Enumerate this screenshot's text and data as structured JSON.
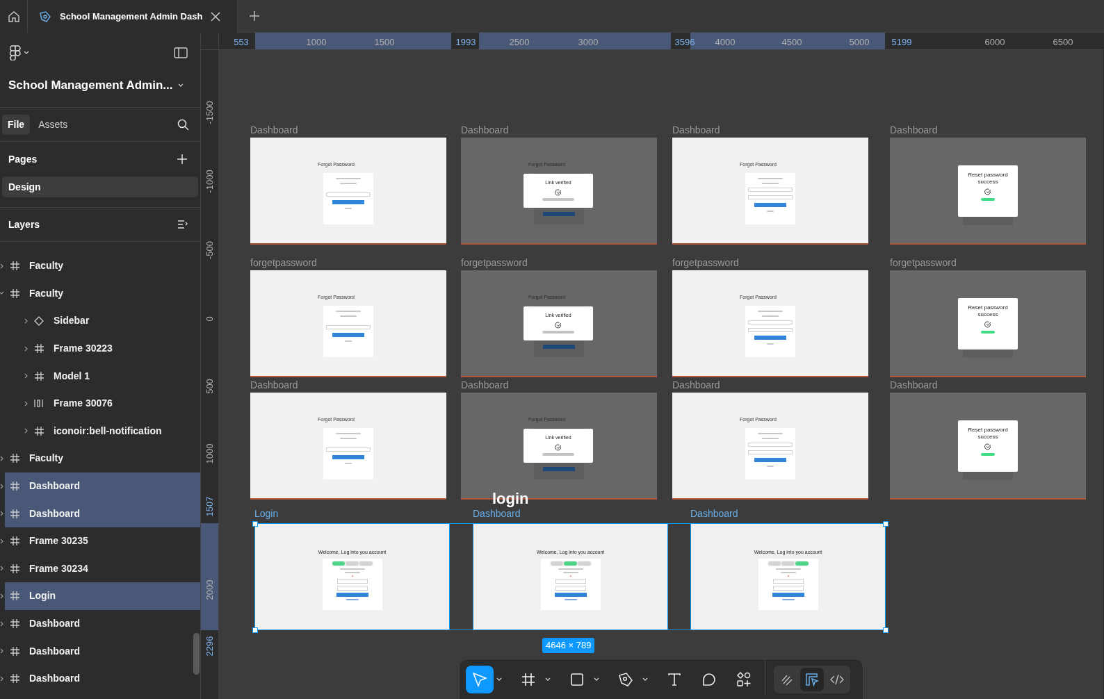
{
  "tab_bar": {
    "document_tab": "School Management Admin Dash"
  },
  "sidebar": {
    "file_name": "School Management Admin...",
    "tabs": [
      {
        "label": "File",
        "selected": true
      },
      {
        "label": "Assets",
        "selected": false
      }
    ],
    "pages_heading": "Pages",
    "pages": [
      {
        "label": "Design",
        "selected": true
      }
    ],
    "layers_heading": "Layers",
    "layers": [
      {
        "name": "Faculty",
        "kind": "frame",
        "expanded": false,
        "selected": false
      },
      {
        "name": "Faculty",
        "kind": "frame",
        "expanded": true,
        "selected": false,
        "children": [
          {
            "name": "Sidebar",
            "kind": "component",
            "expanded": false,
            "selected": false
          },
          {
            "name": "Frame 30223",
            "kind": "frame",
            "expanded": false,
            "selected": false
          },
          {
            "name": "Model 1",
            "kind": "frame",
            "expanded": false,
            "selected": false
          },
          {
            "name": "Frame 30076",
            "kind": "autolayout",
            "expanded": false,
            "selected": false
          },
          {
            "name": "iconoir:bell-notification",
            "kind": "frame",
            "expanded": false,
            "selected": false
          }
        ]
      },
      {
        "name": "Faculty",
        "kind": "frame",
        "expanded": false,
        "selected": false
      },
      {
        "name": "Dashboard",
        "kind": "frame",
        "expanded": false,
        "selected": true
      },
      {
        "name": "Dashboard",
        "kind": "frame",
        "expanded": false,
        "selected": true
      },
      {
        "name": "Frame 30235",
        "kind": "frame",
        "expanded": false,
        "selected": false
      },
      {
        "name": "Frame 30234",
        "kind": "frame",
        "expanded": false,
        "selected": false
      },
      {
        "name": "Login",
        "kind": "frame",
        "expanded": false,
        "selected": true
      },
      {
        "name": "Dashboard",
        "kind": "frame",
        "expanded": false,
        "selected": false
      },
      {
        "name": "Dashboard",
        "kind": "frame",
        "expanded": false,
        "selected": false
      },
      {
        "name": "Dashboard",
        "kind": "frame",
        "expanded": false,
        "selected": false
      }
    ]
  },
  "rulers": {
    "horizontal": [
      {
        "label": "553",
        "highlighted": true
      },
      {
        "label": "1000",
        "highlighted": false
      },
      {
        "label": "1500",
        "highlighted": false
      },
      {
        "label": "1993",
        "highlighted": true
      },
      {
        "label": "2500",
        "highlighted": false
      },
      {
        "label": "3000",
        "highlighted": false
      },
      {
        "label": "3596",
        "highlighted": true
      },
      {
        "label": "4000",
        "highlighted": false
      },
      {
        "label": "4500",
        "highlighted": false
      },
      {
        "label": "5000",
        "highlighted": false
      },
      {
        "label": "5199",
        "highlighted": true
      },
      {
        "label": "6000",
        "highlighted": false
      },
      {
        "label": "6500",
        "highlighted": false
      }
    ],
    "vertical": [
      {
        "label": "-1500",
        "highlighted": false
      },
      {
        "label": "-1000",
        "highlighted": false
      },
      {
        "label": "-500",
        "highlighted": false
      },
      {
        "label": "0",
        "highlighted": false
      },
      {
        "label": "500",
        "highlighted": false
      },
      {
        "label": "1000",
        "highlighted": false
      },
      {
        "label": "1507",
        "highlighted": true
      },
      {
        "label": "2000",
        "highlighted": false
      },
      {
        "label": "2296",
        "highlighted": true
      }
    ]
  },
  "canvas": {
    "frames": [
      {
        "label": "Dashboard",
        "kind": "forgot",
        "title": "Forgot Password"
      },
      {
        "label": "Dashboard",
        "kind": "verified",
        "title": "Forgot Password",
        "modal_title": "Link verified"
      },
      {
        "label": "Dashboard",
        "kind": "new_password",
        "title": "Forgot Password"
      },
      {
        "label": "Dashboard",
        "kind": "reset_success",
        "modal_title": "Reset password success"
      },
      {
        "label": "forgetpassword",
        "kind": "forgot",
        "title": "Forgot Password"
      },
      {
        "label": "forgetpassword",
        "kind": "verified",
        "title": "Forgot Password",
        "modal_title": "Link verified"
      },
      {
        "label": "forgetpassword",
        "kind": "new_password",
        "title": "Forgot Password"
      },
      {
        "label": "forgetpassword",
        "kind": "reset_success",
        "modal_title": "Reset password success"
      },
      {
        "label": "Dashboard",
        "kind": "forgot",
        "title": "Forgot Password"
      },
      {
        "label": "Dashboard",
        "kind": "verified",
        "title": "Forgot Password",
        "modal_title": "Link verified"
      },
      {
        "label": "Dashboard",
        "kind": "new_password",
        "title": "Forgot Password"
      },
      {
        "label": "Dashboard",
        "kind": "reset_success",
        "modal_title": "Reset password success"
      }
    ],
    "login_frames": [
      {
        "label": "Login",
        "title": "Welcome, Log into you account",
        "tabs": [
          {
            "selected": true
          },
          {
            "selected": false
          },
          {
            "selected": false
          }
        ]
      },
      {
        "label": "Dashboard",
        "title": "Welcome, Log into you account",
        "tabs": [
          {
            "selected": false
          },
          {
            "selected": true
          },
          {
            "selected": false
          }
        ]
      },
      {
        "label": "Dashboard",
        "title": "Welcome, Log into you account",
        "tabs": [
          {
            "selected": false
          },
          {
            "selected": false
          },
          {
            "selected": true
          }
        ]
      }
    ],
    "section_label": "login",
    "selection_size": "4646 × 789"
  },
  "toolbar": {
    "tools": [
      {
        "kind": "move",
        "selected": true,
        "has_menu": true
      },
      {
        "kind": "frame",
        "selected": false,
        "has_menu": true
      },
      {
        "kind": "shape",
        "selected": false,
        "has_menu": true
      },
      {
        "kind": "pen",
        "selected": false,
        "has_menu": true
      },
      {
        "kind": "text",
        "selected": false,
        "has_menu": false
      },
      {
        "kind": "comment",
        "selected": false,
        "has_menu": false
      },
      {
        "kind": "actions",
        "selected": false,
        "has_menu": false
      }
    ],
    "modes": [
      {
        "kind": "draw",
        "selected": false
      },
      {
        "kind": "design",
        "selected": true
      },
      {
        "kind": "code",
        "selected": false
      }
    ]
  }
}
